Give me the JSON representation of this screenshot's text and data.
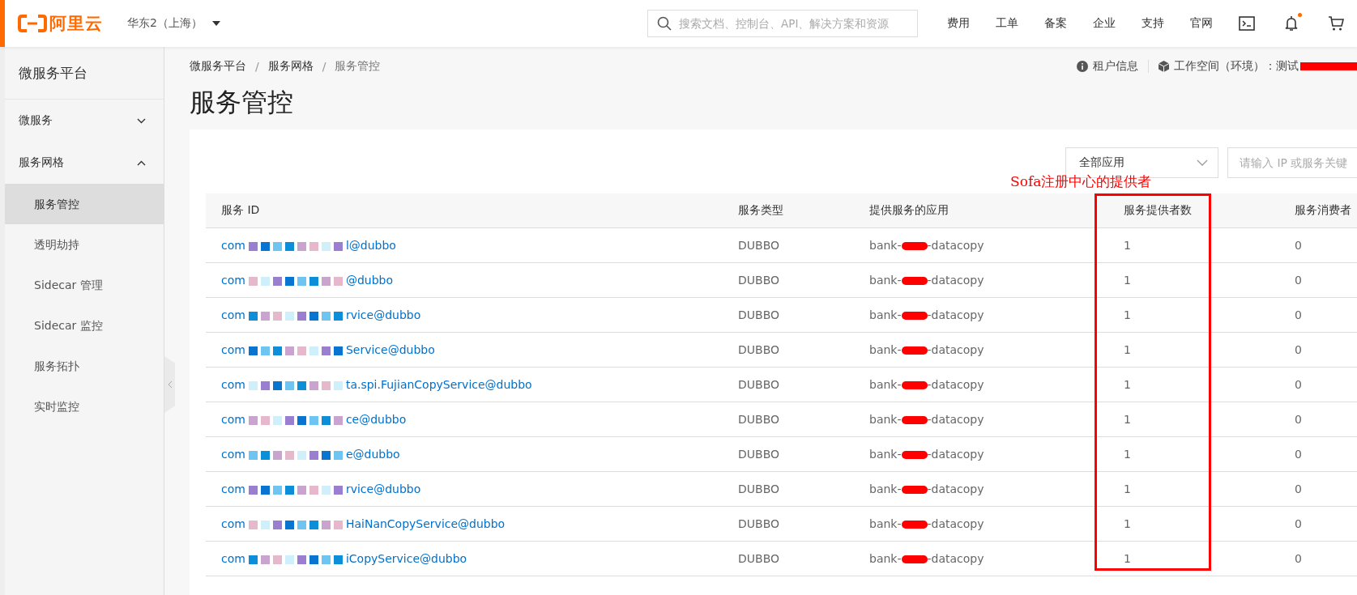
{
  "topbar": {
    "brand": "阿里云",
    "region": "华东2（上海）",
    "search": {
      "placeholder": "搜索文档、控制台、API、解决方案和资源"
    },
    "nav": [
      "费用",
      "工单",
      "备案",
      "企业",
      "支持",
      "官网"
    ],
    "notification_dot": true
  },
  "sidebar": {
    "title": "微服务平台",
    "items": [
      {
        "label": "微服务",
        "expanded": false,
        "selected": false
      },
      {
        "label": "服务网格",
        "expanded": true,
        "selected": false,
        "children": [
          {
            "label": "服务管控",
            "selected": true
          },
          {
            "label": "透明劫持",
            "selected": false
          },
          {
            "label": "Sidecar 管理",
            "selected": false
          },
          {
            "label": "Sidecar 监控",
            "selected": false
          },
          {
            "label": "服务拓扑",
            "selected": false
          },
          {
            "label": "实时监控",
            "selected": false
          }
        ]
      }
    ]
  },
  "breadcrumb": [
    "微服务平台",
    "服务网格",
    "服务管控"
  ],
  "breadcrumb_separator": "/",
  "header_links": {
    "tenant": "租户信息",
    "workspace": "工作空间（环境）：测试"
  },
  "page_title": "服务管控",
  "filters": {
    "app_select": "全部应用",
    "search": {
      "placeholder": "请输入 IP 或服务关键"
    }
  },
  "annotation": {
    "text": "Sofa注册中心的提供者"
  },
  "table": {
    "columns": [
      "服务 ID",
      "服务类型",
      "提供服务的应用",
      "服务提供者数",
      "服务消费者"
    ],
    "rows": [
      {
        "id_start": "com",
        "id_end": "l@dubbo",
        "type": "DUBBO",
        "app_start": "bank-",
        "app_end": "-datacopy",
        "providers": "1",
        "consumers": "0"
      },
      {
        "id_start": "com",
        "id_end": "@dubbo",
        "type": "DUBBO",
        "app_start": "bank-",
        "app_end": "-datacopy",
        "providers": "1",
        "consumers": "0"
      },
      {
        "id_start": "com",
        "id_end": "rvice@dubbo",
        "type": "DUBBO",
        "app_start": "bank-",
        "app_end": "-datacopy",
        "providers": "1",
        "consumers": "0"
      },
      {
        "id_start": "com",
        "id_end": "Service@dubbo",
        "type": "DUBBO",
        "app_start": "bank-",
        "app_end": "-datacopy",
        "providers": "1",
        "consumers": "0"
      },
      {
        "id_start": "com",
        "id_end": "ta.spi.FujianCopyService@dubbo",
        "type": "DUBBO",
        "app_start": "bank-",
        "app_end": "-datacopy",
        "providers": "1",
        "consumers": "0"
      },
      {
        "id_start": "com",
        "id_end": "ce@dubbo",
        "type": "DUBBO",
        "app_start": "bank-",
        "app_end": "-datacopy",
        "providers": "1",
        "consumers": "0"
      },
      {
        "id_start": "com",
        "id_end": "e@dubbo",
        "type": "DUBBO",
        "app_start": "bank-",
        "app_end": "-datacopy",
        "providers": "1",
        "consumers": "0"
      },
      {
        "id_start": "com",
        "id_end": "rvice@dubbo",
        "type": "DUBBO",
        "app_start": "bank-",
        "app_end": "-datacopy",
        "providers": "1",
        "consumers": "0"
      },
      {
        "id_start": "com",
        "id_end": "HaiNanCopyService@dubbo",
        "type": "DUBBO",
        "app_start": "bank-",
        "app_end": "-datacopy",
        "providers": "1",
        "consumers": "0"
      },
      {
        "id_start": "com",
        "id_end": "iCopyService@dubbo",
        "type": "DUBBO",
        "app_start": "bank-",
        "app_end": "-datacopy",
        "providers": "1",
        "consumers": "0"
      }
    ]
  }
}
